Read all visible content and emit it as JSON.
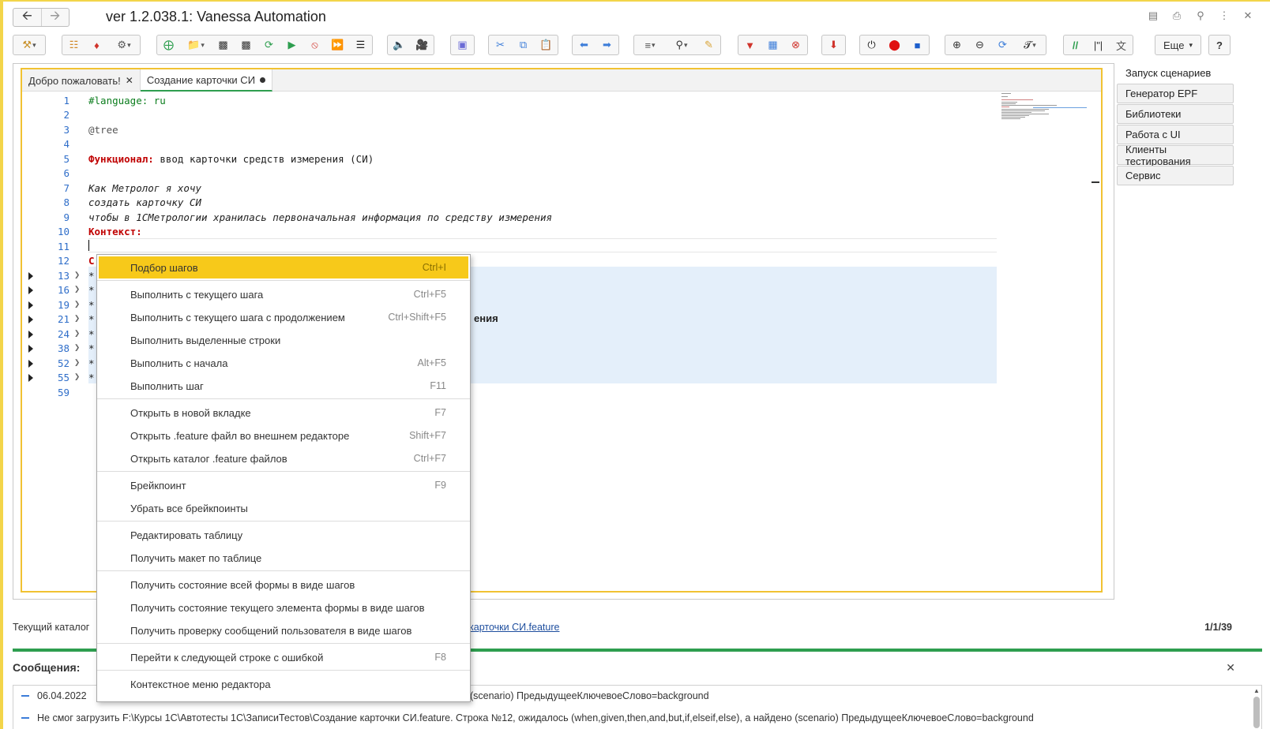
{
  "window": {
    "title": "ver 1.2.038.1: Vanessa Automation"
  },
  "toolbar": {
    "more_label": "Еще",
    "help_label": "?"
  },
  "tabs": [
    {
      "label": "Добро пожаловать!"
    },
    {
      "label": "Создание карточки СИ"
    }
  ],
  "code": {
    "lines": [
      {
        "n": "1",
        "text": "#language: ru"
      },
      {
        "n": "2",
        "text": ""
      },
      {
        "n": "3",
        "text": "@tree"
      },
      {
        "n": "4",
        "text": ""
      },
      {
        "n": "5",
        "kw": "Функционал:",
        "text": " ввод карточки средств измерения (СИ)"
      },
      {
        "n": "6",
        "text": ""
      },
      {
        "n": "7",
        "text": "Как Метролог я хочу"
      },
      {
        "n": "8",
        "text": "создать карточку СИ"
      },
      {
        "n": "9",
        "text": "чтобы в 1СМетрологии хранилась первоначальная информация по средству измерения"
      },
      {
        "n": "10",
        "kw": "Контекст:"
      },
      {
        "n": "11",
        "text": ""
      },
      {
        "n": "12",
        "text": "С"
      },
      {
        "n": "13",
        "text": "*"
      },
      {
        "n": "16",
        "text": "*"
      },
      {
        "n": "19",
        "text": "*"
      },
      {
        "n": "21",
        "text": "*"
      },
      {
        "n": "24",
        "text": "*"
      },
      {
        "n": "38",
        "text": "*"
      },
      {
        "n": "52",
        "text": "*"
      },
      {
        "n": "55",
        "text": "*"
      },
      {
        "n": "59",
        "text": ""
      }
    ],
    "partial_visible": "ения"
  },
  "right_panel": [
    "Запуск сценариев",
    "Генератор EPF",
    "Библиотеки",
    "Работа с UI",
    "Клиенты тестирования",
    "Сервис"
  ],
  "status": {
    "label": "Текущий каталог",
    "link": "карточки СИ.feature",
    "counter": "1/1/39"
  },
  "messages": {
    "title": "Сообщения:",
    "items": [
      {
        "date": "06.04.2022",
        "text": "о (scenario) ПредыдущееКлючевоеСлово=background"
      },
      {
        "text": "Не смог загрузить F:\\Курсы 1С\\Автотесты 1С\\ЗаписиТестов\\Создание карточки СИ.feature. Строка №12, ожидалось (when,given,then,and,but,if,elseif,else), а найдено (scenario) ПредыдущееКлючевоеСлово=background"
      }
    ]
  },
  "context_menu": [
    {
      "label": "Подбор шагов",
      "shortcut": "Ctrl+I"
    },
    {
      "label": "Выполнить с текущего шага",
      "shortcut": "Ctrl+F5"
    },
    {
      "label": "Выполнить с текущего шага с продолжением",
      "shortcut": "Ctrl+Shift+F5"
    },
    {
      "label": "Выполнить выделенные строки",
      "shortcut": ""
    },
    {
      "label": "Выполнить с начала",
      "shortcut": "Alt+F5"
    },
    {
      "label": "Выполнить шаг",
      "shortcut": "F11"
    },
    {
      "label": "Открыть в новой вкладке",
      "shortcut": "F7"
    },
    {
      "label": "Открыть .feature файл во внешнем редакторе",
      "shortcut": "Shift+F7"
    },
    {
      "label": "Открыть каталог .feature файлов",
      "shortcut": "Ctrl+F7"
    },
    {
      "label": "Брейкпоинт",
      "shortcut": "F9"
    },
    {
      "label": "Убрать все брейкпоинты",
      "shortcut": ""
    },
    {
      "label": "Редактировать таблицу",
      "shortcut": ""
    },
    {
      "label": "Получить макет по таблице",
      "shortcut": ""
    },
    {
      "label": "Получить состояние всей формы в виде шагов",
      "shortcut": ""
    },
    {
      "label": "Получить состояние текущего элемента формы в виде шагов",
      "shortcut": ""
    },
    {
      "label": "Получить проверку сообщений пользователя в виде шагов",
      "shortcut": ""
    },
    {
      "label": "Перейти к следующей строке с ошибкой",
      "shortcut": "F8"
    },
    {
      "label": "Контекстное меню редактора",
      "shortcut": ""
    }
  ],
  "colors": {
    "accent": "#f7c91a",
    "frame": "#f1c232",
    "green": "#2e9e4f",
    "keyword": "#c00000",
    "link": "#1e4e9e"
  }
}
